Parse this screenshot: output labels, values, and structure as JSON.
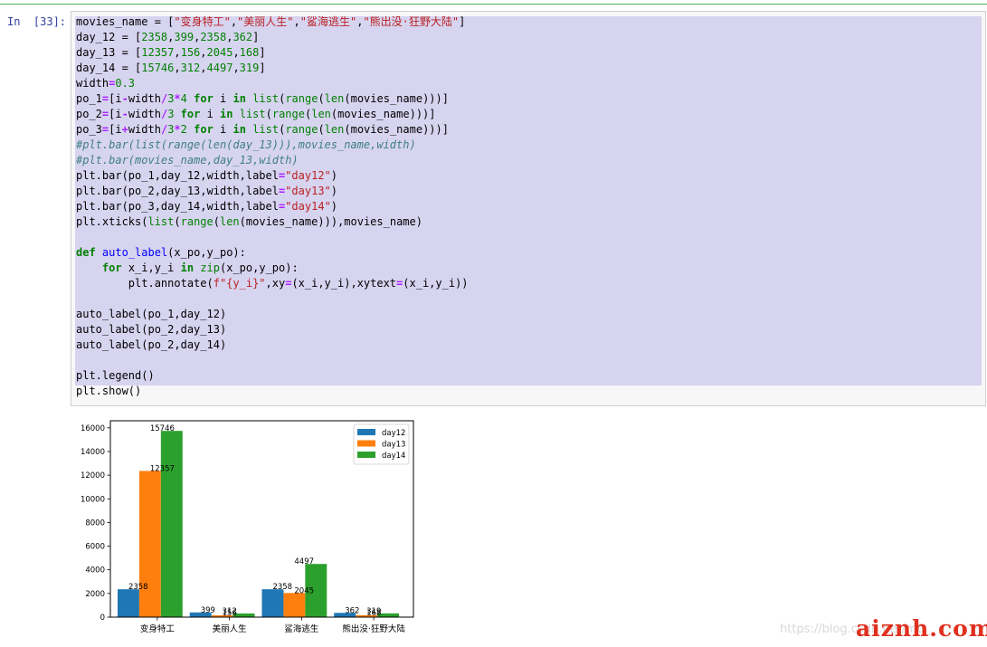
{
  "cell": {
    "prompt": "In  [33]:",
    "lines": [
      [
        [
          "plain",
          "movies_name = ["
        ],
        [
          "str",
          "\"变身特工\""
        ],
        [
          "plain",
          ","
        ],
        [
          "str",
          "\"美丽人生\""
        ],
        [
          "plain",
          ","
        ],
        [
          "str",
          "\"鲨海逃生\""
        ],
        [
          "plain",
          ","
        ],
        [
          "str",
          "\"熊出没·狂野大陆\""
        ],
        [
          "plain",
          "]"
        ]
      ],
      [
        [
          "plain",
          "day_12 = ["
        ],
        [
          "num",
          "2358"
        ],
        [
          "plain",
          ","
        ],
        [
          "num",
          "399"
        ],
        [
          "plain",
          ","
        ],
        [
          "num",
          "2358"
        ],
        [
          "plain",
          ","
        ],
        [
          "num",
          "362"
        ],
        [
          "plain",
          "]"
        ]
      ],
      [
        [
          "plain",
          "day_13 = ["
        ],
        [
          "num",
          "12357"
        ],
        [
          "plain",
          ","
        ],
        [
          "num",
          "156"
        ],
        [
          "plain",
          ","
        ],
        [
          "num",
          "2045"
        ],
        [
          "plain",
          ","
        ],
        [
          "num",
          "168"
        ],
        [
          "plain",
          "]"
        ]
      ],
      [
        [
          "plain",
          "day_14 = ["
        ],
        [
          "num",
          "15746"
        ],
        [
          "plain",
          ","
        ],
        [
          "num",
          "312"
        ],
        [
          "plain",
          ","
        ],
        [
          "num",
          "4497"
        ],
        [
          "plain",
          ","
        ],
        [
          "num",
          "319"
        ],
        [
          "plain",
          "]"
        ]
      ],
      [
        [
          "plain",
          "width"
        ],
        [
          "op",
          "="
        ],
        [
          "num",
          "0.3"
        ]
      ],
      [
        [
          "plain",
          "po_1"
        ],
        [
          "op",
          "="
        ],
        [
          "plain",
          "[i"
        ],
        [
          "op",
          "-"
        ],
        [
          "plain",
          "width"
        ],
        [
          "op",
          "/"
        ],
        [
          "num",
          "3"
        ],
        [
          "op",
          "*"
        ],
        [
          "num",
          "4"
        ],
        [
          "plain",
          " "
        ],
        [
          "kw",
          "for"
        ],
        [
          "plain",
          " i "
        ],
        [
          "kw",
          "in"
        ],
        [
          "plain",
          " "
        ],
        [
          "bi",
          "list"
        ],
        [
          "plain",
          "("
        ],
        [
          "bi",
          "range"
        ],
        [
          "plain",
          "("
        ],
        [
          "bi",
          "len"
        ],
        [
          "plain",
          "(movies_name)))]"
        ]
      ],
      [
        [
          "plain",
          "po_2"
        ],
        [
          "op",
          "="
        ],
        [
          "plain",
          "[i"
        ],
        [
          "op",
          "-"
        ],
        [
          "plain",
          "width"
        ],
        [
          "op",
          "/"
        ],
        [
          "num",
          "3"
        ],
        [
          "plain",
          " "
        ],
        [
          "kw",
          "for"
        ],
        [
          "plain",
          " i "
        ],
        [
          "kw",
          "in"
        ],
        [
          "plain",
          " "
        ],
        [
          "bi",
          "list"
        ],
        [
          "plain",
          "("
        ],
        [
          "bi",
          "range"
        ],
        [
          "plain",
          "("
        ],
        [
          "bi",
          "len"
        ],
        [
          "plain",
          "(movies_name)))]"
        ]
      ],
      [
        [
          "plain",
          "po_3"
        ],
        [
          "op",
          "="
        ],
        [
          "plain",
          "[i"
        ],
        [
          "op",
          "+"
        ],
        [
          "plain",
          "width"
        ],
        [
          "op",
          "/"
        ],
        [
          "num",
          "3"
        ],
        [
          "op",
          "*"
        ],
        [
          "num",
          "2"
        ],
        [
          "plain",
          " "
        ],
        [
          "kw",
          "for"
        ],
        [
          "plain",
          " i "
        ],
        [
          "kw",
          "in"
        ],
        [
          "plain",
          " "
        ],
        [
          "bi",
          "list"
        ],
        [
          "plain",
          "("
        ],
        [
          "bi",
          "range"
        ],
        [
          "plain",
          "("
        ],
        [
          "bi",
          "len"
        ],
        [
          "plain",
          "(movies_name)))]"
        ]
      ],
      [
        [
          "cm",
          "#plt.bar(list(range(len(day_13))),movies_name,width)"
        ]
      ],
      [
        [
          "cm",
          "#plt.bar(movies_name,day_13,width)"
        ]
      ],
      [
        [
          "plain",
          "plt.bar(po_1,day_12,width,label"
        ],
        [
          "op",
          "="
        ],
        [
          "str",
          "\"day12\""
        ],
        [
          "plain",
          ")"
        ]
      ],
      [
        [
          "plain",
          "plt.bar(po_2,day_13,width,label"
        ],
        [
          "op",
          "="
        ],
        [
          "str",
          "\"day13\""
        ],
        [
          "plain",
          ")"
        ]
      ],
      [
        [
          "plain",
          "plt.bar(po_3,day_14,width,label"
        ],
        [
          "op",
          "="
        ],
        [
          "str",
          "\"day14\""
        ],
        [
          "plain",
          ")"
        ]
      ],
      [
        [
          "plain",
          "plt.xticks("
        ],
        [
          "bi",
          "list"
        ],
        [
          "plain",
          "("
        ],
        [
          "bi",
          "range"
        ],
        [
          "plain",
          "("
        ],
        [
          "bi",
          "len"
        ],
        [
          "plain",
          "(movies_name))),movies_name)"
        ]
      ],
      [],
      [
        [
          "kw",
          "def"
        ],
        [
          "plain",
          " "
        ],
        [
          "fn",
          "auto_label"
        ],
        [
          "plain",
          "(x_po,y_po):"
        ]
      ],
      [
        [
          "plain",
          "    "
        ],
        [
          "kw",
          "for"
        ],
        [
          "plain",
          " x_i,y_i "
        ],
        [
          "kw",
          "in"
        ],
        [
          "plain",
          " "
        ],
        [
          "bi",
          "zip"
        ],
        [
          "plain",
          "(x_po,y_po):"
        ]
      ],
      [
        [
          "plain",
          "        plt.annotate("
        ],
        [
          "str",
          "f\"{y_i}\""
        ],
        [
          "plain",
          ",xy"
        ],
        [
          "op",
          "="
        ],
        [
          "plain",
          "(x_i,y_i),xytext"
        ],
        [
          "op",
          "="
        ],
        [
          "plain",
          "(x_i,y_i))"
        ]
      ],
      [],
      [
        [
          "plain",
          "auto_label(po_1,day_12)"
        ]
      ],
      [
        [
          "plain",
          "auto_label(po_2,day_13)"
        ]
      ],
      [
        [
          "plain",
          "auto_label(po_2,day_14)"
        ]
      ],
      [],
      [
        [
          "plain",
          "plt.legend()"
        ]
      ],
      [
        [
          "plain",
          "plt.show()"
        ]
      ]
    ]
  },
  "colors": {
    "day12": "#1f77b4",
    "day13": "#ff7f0e",
    "day14": "#2ca02c"
  },
  "chart_data": {
    "type": "bar",
    "categories": [
      "变身特工",
      "美丽人生",
      "鲨海逃生",
      "熊出没·狂野大陆"
    ],
    "series": [
      {
        "name": "day12",
        "values": [
          2358,
          399,
          2358,
          362
        ]
      },
      {
        "name": "day13",
        "values": [
          12357,
          156,
          2045,
          168
        ]
      },
      {
        "name": "day14",
        "values": [
          15746,
          312,
          4497,
          319
        ]
      }
    ],
    "annotations": [
      {
        "text": "2358",
        "x": -0.4,
        "y": 2358
      },
      {
        "text": "399",
        "x": 0.6,
        "y": 399
      },
      {
        "text": "2358",
        "x": 1.6,
        "y": 2358
      },
      {
        "text": "362",
        "x": 2.6,
        "y": 362
      },
      {
        "text": "12357",
        "x": -0.1,
        "y": 12357
      },
      {
        "text": "156",
        "x": 0.9,
        "y": 156
      },
      {
        "text": "2045",
        "x": 1.9,
        "y": 2045
      },
      {
        "text": "168",
        "x": 2.9,
        "y": 168
      },
      {
        "text": "15746",
        "x": -0.1,
        "y": 15746
      },
      {
        "text": "312",
        "x": 0.9,
        "y": 312
      },
      {
        "text": "4497",
        "x": 1.9,
        "y": 4497
      },
      {
        "text": "319",
        "x": 2.9,
        "y": 319
      }
    ],
    "yticks": [
      0,
      2000,
      4000,
      6000,
      8000,
      10000,
      12000,
      14000,
      16000
    ],
    "xlim": [
      -0.65,
      3.55
    ],
    "ylim": [
      0,
      16600
    ],
    "legend": "top-right",
    "grid": false
  },
  "watermark": {
    "url": "https://blog.csdn.net/m0_",
    "brand": "aiznh.com"
  }
}
